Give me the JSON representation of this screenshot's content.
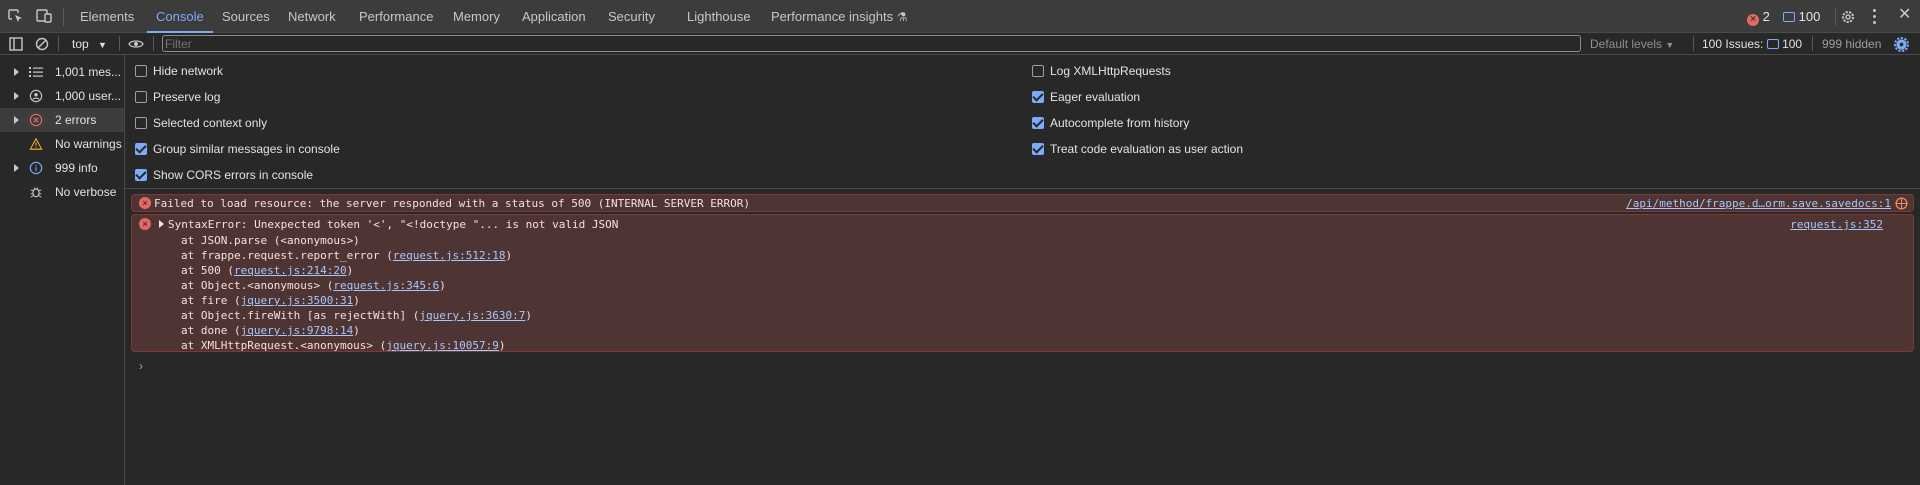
{
  "tabs": [
    "Elements",
    "Console",
    "Sources",
    "Network",
    "Performance",
    "Memory",
    "Application",
    "Security",
    "Lighthouse",
    "Performance insights"
  ],
  "active_tab": "Console",
  "header_right": {
    "errors": "2",
    "messages": "100"
  },
  "toolbar": {
    "context": "top",
    "filter_placeholder": "Filter",
    "levels": "Default levels",
    "issues_label": "100 Issues:",
    "issues_count": "100",
    "hidden": "999 hidden"
  },
  "sidebar": [
    {
      "label": "1,001 mes...",
      "icon": "list-icon",
      "expandable": true
    },
    {
      "label": "1,000 user...",
      "icon": "user-icon",
      "expandable": true
    },
    {
      "label": "2 errors",
      "icon": "error-icon",
      "expandable": true,
      "selected": true
    },
    {
      "label": "No warnings",
      "icon": "warning-icon",
      "expandable": false
    },
    {
      "label": "999 info",
      "icon": "info-icon",
      "expandable": true
    },
    {
      "label": "No verbose",
      "icon": "bug-icon",
      "expandable": false
    }
  ],
  "settings_left": [
    {
      "label": "Hide network",
      "checked": false
    },
    {
      "label": "Preserve log",
      "checked": false
    },
    {
      "label": "Selected context only",
      "checked": false
    },
    {
      "label": "Group similar messages in console",
      "checked": true
    },
    {
      "label": "Show CORS errors in console",
      "checked": true
    }
  ],
  "settings_right": [
    {
      "label": "Log XMLHttpRequests",
      "checked": false
    },
    {
      "label": "Eager evaluation",
      "checked": true
    },
    {
      "label": "Autocomplete from history",
      "checked": true
    },
    {
      "label": "Treat code evaluation as user action",
      "checked": true
    }
  ],
  "messages": {
    "error1": {
      "text": "Failed to load resource: the server responded with a status of 500 (INTERNAL SERVER ERROR)",
      "source": "/api/method/frappe.d…orm.save.savedocs:1"
    },
    "error2": {
      "text": "SyntaxError: Unexpected token '<', \"<!doctype \"... is not valid JSON",
      "source": "request.js:352",
      "stack": [
        {
          "pre": "at JSON.parse (<anonymous>)",
          "link": "",
          "post": ""
        },
        {
          "pre": "at frappe.request.report_error (",
          "link": "request.js:512:18",
          "post": ")"
        },
        {
          "pre": "at 500 (",
          "link": "request.js:214:20",
          "post": ")"
        },
        {
          "pre": "at Object.<anonymous> (",
          "link": "request.js:345:6",
          "post": ")"
        },
        {
          "pre": "at fire (",
          "link": "jquery.js:3500:31",
          "post": ")"
        },
        {
          "pre": "at Object.fireWith [as rejectWith] (",
          "link": "jquery.js:3630:7",
          "post": ")"
        },
        {
          "pre": "at done (",
          "link": "jquery.js:9798:14",
          "post": ")"
        },
        {
          "pre": "at XMLHttpRequest.<anonymous> (",
          "link": "jquery.js:10057:9",
          "post": ")"
        }
      ]
    }
  },
  "prompt": "›",
  "colors": {
    "accent": "#7cacf8",
    "error": "#e46962",
    "error_bg": "#4e3534"
  }
}
